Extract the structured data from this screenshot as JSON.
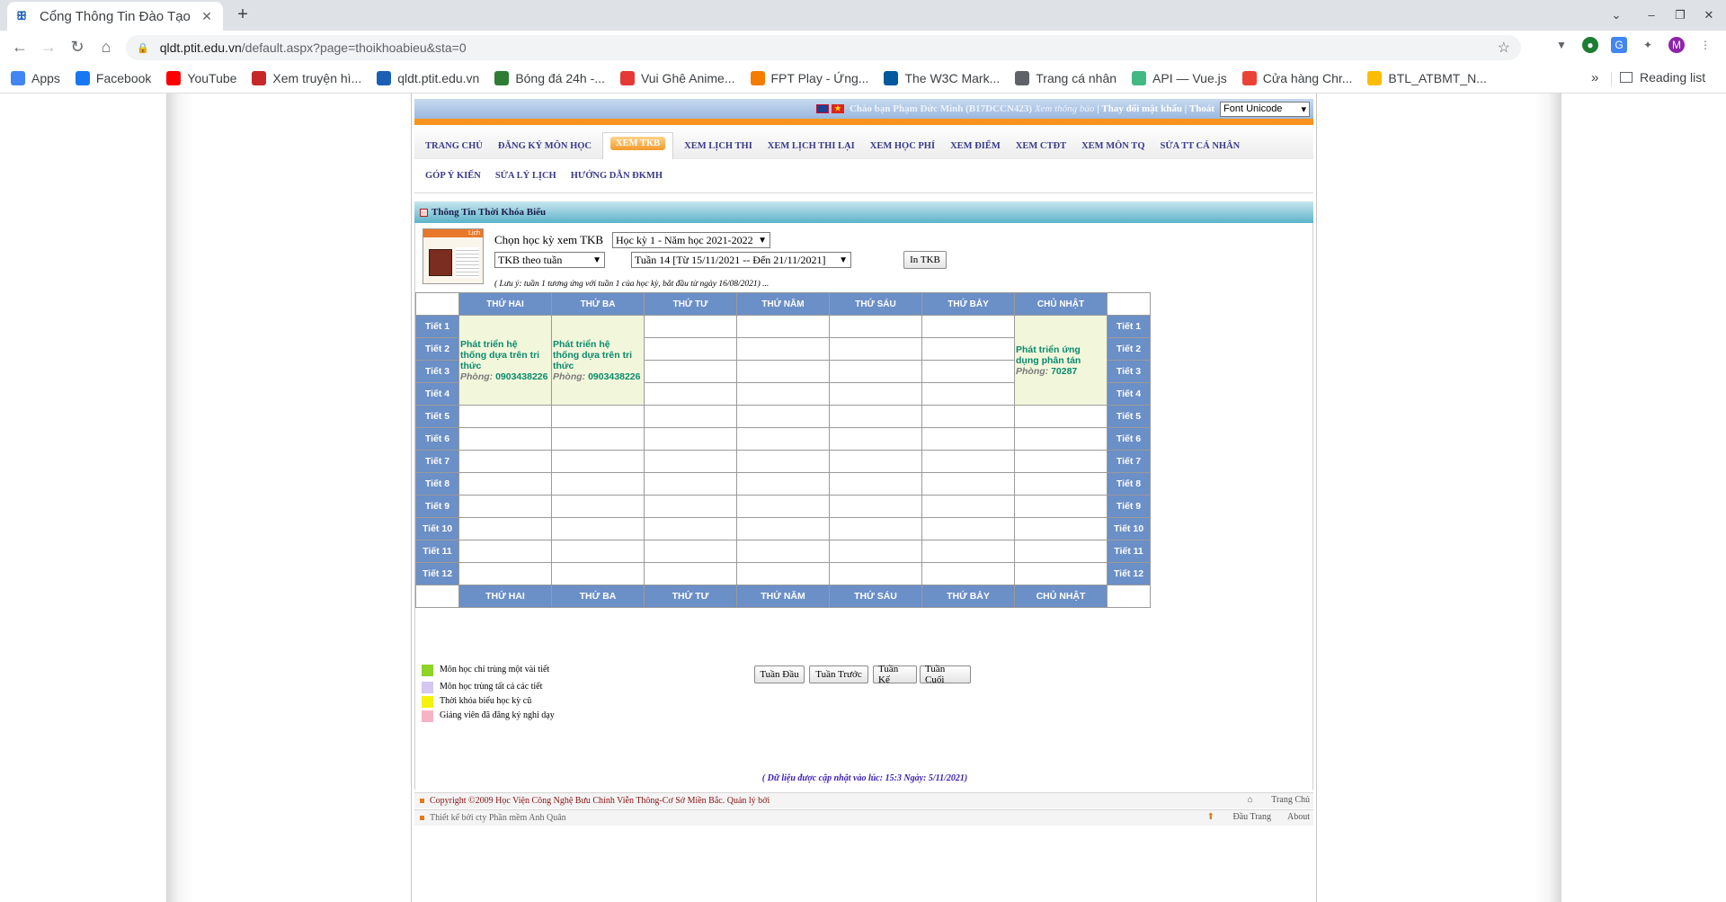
{
  "browser": {
    "tab_title": "Cổng Thông Tin Đào Tạo",
    "url_host": "qldt.ptit.edu.vn",
    "url_path": "/default.aspx?page=thoikhoabieu&sta=0",
    "bookmarks": [
      {
        "label": "Apps",
        "icon": "apps-grid-icon",
        "color": "#4285f4"
      },
      {
        "label": "Facebook",
        "icon": "facebook-icon",
        "color": "#1877f2"
      },
      {
        "label": "YouTube",
        "icon": "youtube-icon",
        "color": "#ff0000"
      },
      {
        "label": "Xem truyện hì...",
        "icon": "comic-site-icon",
        "color": "#c62828"
      },
      {
        "label": "qldt.ptit.edu.vn",
        "icon": "ptit-icon",
        "color": "#1a5fb4"
      },
      {
        "label": "Bóng đá 24h -...",
        "icon": "football-site-icon",
        "color": "#2e7d32"
      },
      {
        "label": "Vui Ghê Anime...",
        "icon": "anime-site-icon",
        "color": "#e53935"
      },
      {
        "label": "FPT Play - Ứng...",
        "icon": "fpt-play-icon",
        "color": "#f57c00"
      },
      {
        "label": "The W3C Mark...",
        "icon": "w3c-icon",
        "color": "#005a9c"
      },
      {
        "label": "Trang cá nhân",
        "icon": "globe-icon",
        "color": "#5f6368"
      },
      {
        "label": "API — Vue.js",
        "icon": "vue-icon",
        "color": "#42b883"
      },
      {
        "label": "Cửa hàng Chr...",
        "icon": "chrome-store-icon",
        "color": "#ea4335"
      },
      {
        "label": "BTL_ATBMT_N...",
        "icon": "google-drive-icon",
        "color": "#fbbc04"
      }
    ],
    "more": "»",
    "reading_list": "Reading list",
    "profile_initial": "M"
  },
  "header": {
    "greeting": "Chào bạn Phạm Đức Minh (B17DCCN423)",
    "view_notice": "Xem thông báo",
    "change_password": "Thay đổi mật khẩu",
    "logout": "Thoát",
    "font_select": "Font Unicode"
  },
  "menu": {
    "main": [
      "TRANG CHỦ",
      "ĐĂNG KÝ MÔN HỌC",
      "XEM TKB",
      "XEM LỊCH THI",
      "XEM LỊCH THI LẠI",
      "XEM HỌC PHÍ",
      "XEM ĐIỂM",
      "XEM CTĐT",
      "XEM MÔN TQ",
      "SỬA TT CÁ NHÂN"
    ],
    "active_index": 2,
    "sub": [
      "GÓP Ý KIẾN",
      "SỬA LÝ LỊCH",
      "HƯỚNG DẪN ĐKMH"
    ]
  },
  "panel": {
    "title": "Thông Tin Thời Khóa Biểu",
    "calendar_label": "Lịch",
    "choose_label": "Chọn học kỳ xem TKB",
    "semester": "Học kỳ 1 - Năm học 2021-2022",
    "view_mode": "TKB theo tuần",
    "week": "Tuần 14 [Từ 15/11/2021 -- Đến 21/11/2021]",
    "print_button": "In TKB",
    "note": "( Lưu ý: tuần 1 tương ứng với tuần 1 của học kỳ, bắt đầu từ ngày 16/08/2021) ..."
  },
  "timetable": {
    "days": [
      "THỨ HAI",
      "THỨ BA",
      "THỨ TƯ",
      "THỨ NĂM",
      "THỨ SÁU",
      "THỨ BẢY",
      "CHỦ NHẬT"
    ],
    "periods": [
      "Tiết 1",
      "Tiết 2",
      "Tiết 3",
      "Tiết 4",
      "Tiết 5",
      "Tiết 6",
      "Tiết 7",
      "Tiết 8",
      "Tiết 9",
      "Tiết 10",
      "Tiết 11",
      "Tiết 12"
    ],
    "courses": [
      {
        "day": "THỨ HAI",
        "start_period": 1,
        "span": 4,
        "name": "Phát triển hệ thống dựa trên tri thức",
        "room_label": "Phòng:",
        "room": "0903438226"
      },
      {
        "day": "THỨ BA",
        "start_period": 1,
        "span": 4,
        "name": "Phát triển hệ thống dựa trên tri thức",
        "room_label": "Phòng:",
        "room": "0903438226"
      },
      {
        "day": "CHỦ NHẬT",
        "start_period": 1,
        "span": 4,
        "name": "Phát triển ứng dụng phân tán",
        "room_label": "Phòng:",
        "room": "70287"
      }
    ]
  },
  "legend": [
    {
      "color": "#8ed327",
      "label": "Môn học chỉ trùng một vài tiết"
    },
    {
      "color": "#d4c7f2",
      "label": "Môn học trùng tất cả các tiết"
    },
    {
      "color": "#f5f20f",
      "label": "Thời khóa biểu học kỳ cũ"
    },
    {
      "color": "#f7b3c6",
      "label": "Giảng viên đã đăng ký nghỉ dạy"
    }
  ],
  "week_nav": [
    "Tuần Đầu",
    "Tuần Trước",
    "Tuần Kế",
    "Tuần Cuối"
  ],
  "updated": "( Dữ liệu được cập nhật vào lúc: 15:3 Ngày: 5/11/2021)",
  "footer": {
    "copyright": "Copyright ©2009 Học Viện Công Nghệ Bưu Chính Viễn Thông-Cơ Sở Miền Bắc. Quản lý bởi",
    "designed_by": "Thiết kế bởi cty Phần mềm Anh Quân",
    "home": "Trang Chủ",
    "top": "Đầu Trang",
    "about": "About"
  }
}
